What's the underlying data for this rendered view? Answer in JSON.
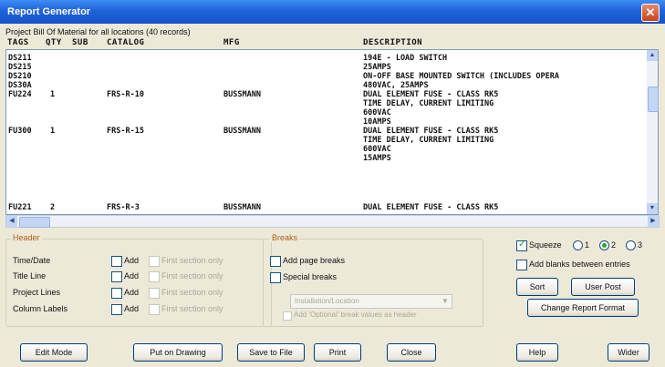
{
  "window": {
    "title": "Report Generator",
    "close_glyph": "✕"
  },
  "subtitle": "Project Bill Of Material for all locations (40 records)",
  "columns": [
    "TAGS",
    "QTY",
    "SUB",
    "CATALOG",
    "MFG",
    "DESCRIPTION"
  ],
  "rows": [
    {
      "tag": "DS211",
      "qty": "",
      "sub": "",
      "catalog": "",
      "mfg": "",
      "desc": "194E - LOAD SWITCH"
    },
    {
      "tag": "DS215",
      "qty": "",
      "sub": "",
      "catalog": "",
      "mfg": "",
      "desc": "25AMPS"
    },
    {
      "tag": "DS210",
      "qty": "",
      "sub": "",
      "catalog": "",
      "mfg": "",
      "desc": "ON-OFF BASE MOUNTED SWITCH (INCLUDES OPERA"
    },
    {
      "tag": "DS30A",
      "qty": "",
      "sub": "",
      "catalog": "",
      "mfg": "",
      "desc": "480VAC, 25AMPS"
    },
    {
      "tag": "FU224",
      "qty": "1",
      "sub": "",
      "catalog": "FRS-R-10",
      "mfg": "BUSSMANN",
      "desc": "DUAL ELEMENT FUSE - CLASS RK5"
    },
    {
      "tag": "",
      "qty": "",
      "sub": "",
      "catalog": "",
      "mfg": "",
      "desc": "TIME DELAY, CURRENT LIMITING"
    },
    {
      "tag": "",
      "qty": "",
      "sub": "",
      "catalog": "",
      "mfg": "",
      "desc": "600VAC"
    },
    {
      "tag": "",
      "qty": "",
      "sub": "",
      "catalog": "",
      "mfg": "",
      "desc": "10AMPS"
    },
    {
      "tag": "FU300",
      "qty": "1",
      "sub": "",
      "catalog": "FRS-R-15",
      "mfg": "BUSSMANN",
      "desc": "DUAL ELEMENT FUSE - CLASS RK5"
    },
    {
      "tag": "",
      "qty": "",
      "sub": "",
      "catalog": "",
      "mfg": "",
      "desc": "TIME DELAY, CURRENT LIMITING"
    },
    {
      "tag": "",
      "qty": "",
      "sub": "",
      "catalog": "",
      "mfg": "",
      "desc": "600VAC"
    },
    {
      "tag": "",
      "qty": "",
      "sub": "",
      "catalog": "",
      "mfg": "",
      "desc": "15AMPS"
    },
    {
      "tag": "FU221",
      "qty": "2",
      "sub": "",
      "catalog": "FRS-R-3",
      "mfg": "BUSSMANN",
      "desc": "DUAL ELEMENT FUSE - CLASS RK5"
    }
  ],
  "header_group": {
    "title": "Header",
    "rows": [
      {
        "label": "Time/Date",
        "add": "Add",
        "first": "First section only"
      },
      {
        "label": "Title Line",
        "add": "Add",
        "first": "First section only"
      },
      {
        "label": "Project Lines",
        "add": "Add",
        "first": "First section only"
      },
      {
        "label": "Column Labels",
        "add": "Add",
        "first": "First section only"
      }
    ]
  },
  "breaks_group": {
    "title": "Breaks",
    "add_page_breaks": "Add page breaks",
    "special_breaks": "Special breaks",
    "combo_value": "Installation/Location",
    "add_optional": "Add 'Optional' break values as header"
  },
  "options": {
    "squeeze": "Squeeze",
    "radio_labels": [
      "1",
      "2",
      "3"
    ],
    "add_blanks": "Add blanks between entries",
    "sort": "Sort",
    "user_post": "User Post",
    "change_format": "Change Report Format"
  },
  "bottom_buttons": [
    "Edit Mode",
    "Put on Drawing",
    "Save to File",
    "Print",
    "Close",
    "Help",
    "Wider"
  ],
  "scroll_glyphs": {
    "up": "▲",
    "down": "▼",
    "left": "◀",
    "right": "▶"
  }
}
